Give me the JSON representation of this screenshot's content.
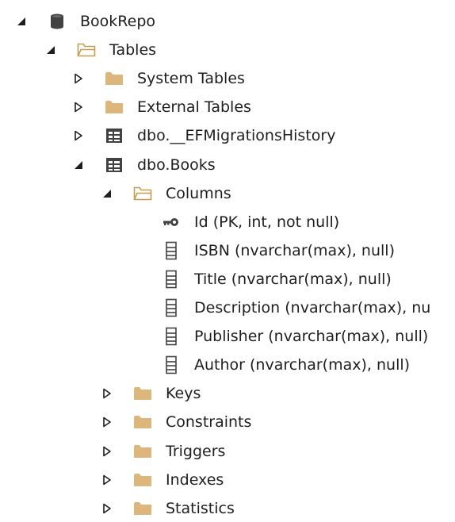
{
  "colors": {
    "folder": "#dcb67a",
    "folder_outline": "#c69c4e",
    "icon_dark": "#424242",
    "text": "#1e1e1e",
    "background": "#ffffff"
  },
  "tree": {
    "nodes": [
      {
        "label": "BookRepo",
        "icon": "database-icon",
        "state": "expanded",
        "depth": 0
      },
      {
        "label": "Tables",
        "icon": "folder-open-icon",
        "state": "expanded",
        "depth": 1
      },
      {
        "label": "System Tables",
        "icon": "folder-icon",
        "state": "collapsed",
        "depth": 2
      },
      {
        "label": "External Tables",
        "icon": "folder-icon",
        "state": "collapsed",
        "depth": 2
      },
      {
        "label": "dbo.__EFMigrationsHistory",
        "icon": "table-icon",
        "state": "collapsed",
        "depth": 2
      },
      {
        "label": "dbo.Books",
        "icon": "table-icon",
        "state": "expanded",
        "depth": 2
      },
      {
        "label": "Columns",
        "icon": "folder-open-icon",
        "state": "expanded",
        "depth": 3
      },
      {
        "label": "Id (PK, int, not null)",
        "icon": "key-icon",
        "state": "leaf",
        "depth": 4
      },
      {
        "label": "ISBN (nvarchar(max), null)",
        "icon": "column-icon",
        "state": "leaf",
        "depth": 4
      },
      {
        "label": "Title (nvarchar(max), null)",
        "icon": "column-icon",
        "state": "leaf",
        "depth": 4
      },
      {
        "label": "Description (nvarchar(max), nu",
        "icon": "column-icon",
        "state": "leaf",
        "depth": 4
      },
      {
        "label": "Publisher (nvarchar(max), null)",
        "icon": "column-icon",
        "state": "leaf",
        "depth": 4
      },
      {
        "label": "Author (nvarchar(max), null)",
        "icon": "column-icon",
        "state": "leaf",
        "depth": 4
      },
      {
        "label": "Keys",
        "icon": "folder-icon",
        "state": "collapsed",
        "depth": 3
      },
      {
        "label": "Constraints",
        "icon": "folder-icon",
        "state": "collapsed",
        "depth": 3
      },
      {
        "label": "Triggers",
        "icon": "folder-icon",
        "state": "collapsed",
        "depth": 3
      },
      {
        "label": "Indexes",
        "icon": "folder-icon",
        "state": "collapsed",
        "depth": 3
      },
      {
        "label": "Statistics",
        "icon": "folder-icon",
        "state": "collapsed",
        "depth": 3
      }
    ]
  }
}
